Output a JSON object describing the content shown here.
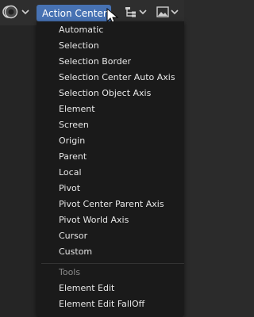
{
  "header": {
    "action_centers_label": "Action Centers"
  },
  "menu": {
    "items": [
      "Automatic",
      "Selection",
      "Selection Border",
      "Selection Center Auto Axis",
      "Selection Object Axis",
      "Element",
      "Screen",
      "Origin",
      "Parent",
      "Local",
      "Pivot",
      "Pivot Center Parent Axis",
      "Pivot World Axis",
      "Cursor",
      "Custom"
    ],
    "tools_title": "Tools",
    "tools_items": [
      "Element Edit",
      "Element Edit FallOff"
    ]
  },
  "colors": {
    "accent": "#4772b3",
    "menu_bg": "#1a1a1a"
  }
}
